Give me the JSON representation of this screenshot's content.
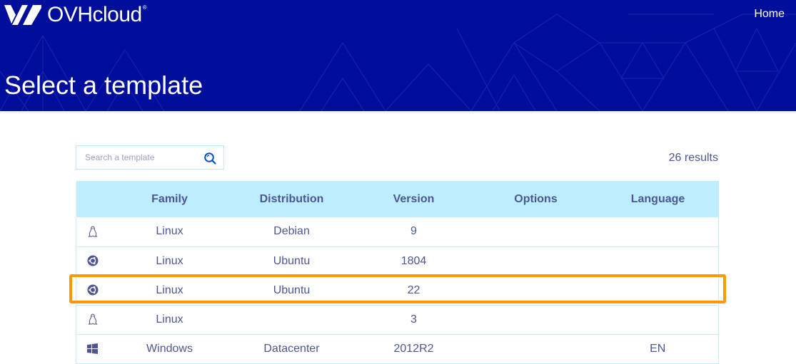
{
  "header": {
    "brand": "OVHcloud",
    "brand_mark": "®",
    "nav_home": "Home",
    "title": "Select a template",
    "background_color": "#000e9c"
  },
  "toolbar": {
    "search_placeholder": "Search a template",
    "search_value": "",
    "search_icon": "search-icon",
    "results_text": "26 results"
  },
  "table": {
    "columns": [
      "",
      "Family",
      "Distribution",
      "Version",
      "Options",
      "Language"
    ],
    "rows": [
      {
        "icon": "linux-tux-icon",
        "family": "Linux",
        "distribution": "Debian",
        "version": "9",
        "options": "",
        "language": ""
      },
      {
        "icon": "ubuntu-icon",
        "family": "Linux",
        "distribution": "Ubuntu",
        "version": "1804",
        "options": "",
        "language": ""
      },
      {
        "icon": "ubuntu-icon",
        "family": "Linux",
        "distribution": "Ubuntu",
        "version": "22",
        "options": "",
        "language": ""
      },
      {
        "icon": "linux-tux-icon",
        "family": "Linux",
        "distribution": "",
        "version": "3",
        "options": "",
        "language": ""
      },
      {
        "icon": "windows-icon",
        "family": "Windows",
        "distribution": "Datacenter",
        "version": "2012R2",
        "options": "",
        "language": "EN"
      }
    ],
    "highlighted_row": 2,
    "highlight_color": "#ff9802",
    "header_color": "#bdeeff",
    "text_color": "#4d5693"
  }
}
